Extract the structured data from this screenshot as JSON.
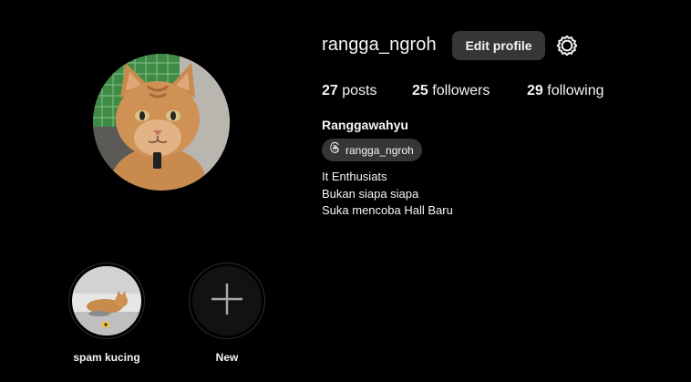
{
  "profile": {
    "username": "rangga_ngroh",
    "edit_label": "Edit profile",
    "settings_icon": "gear-icon",
    "stats": {
      "posts_count": "27",
      "posts_label": "posts",
      "followers_count": "25",
      "followers_label": "followers",
      "following_count": "29",
      "following_label": "following"
    },
    "full_name": "Ranggawahyu",
    "threads_handle": "rangga_ngroh",
    "bio": [
      "It Enthusiats",
      "Bukan siapa siapa",
      "Suka mencoba Hall Baru"
    ]
  },
  "highlights": [
    {
      "label": "spam kucing"
    },
    {
      "label": "New",
      "icon": "plus-icon"
    }
  ],
  "colors": {
    "background": "#000000",
    "button": "#363636",
    "text": "#f5f5f5",
    "ring": "#2e2e2e"
  }
}
